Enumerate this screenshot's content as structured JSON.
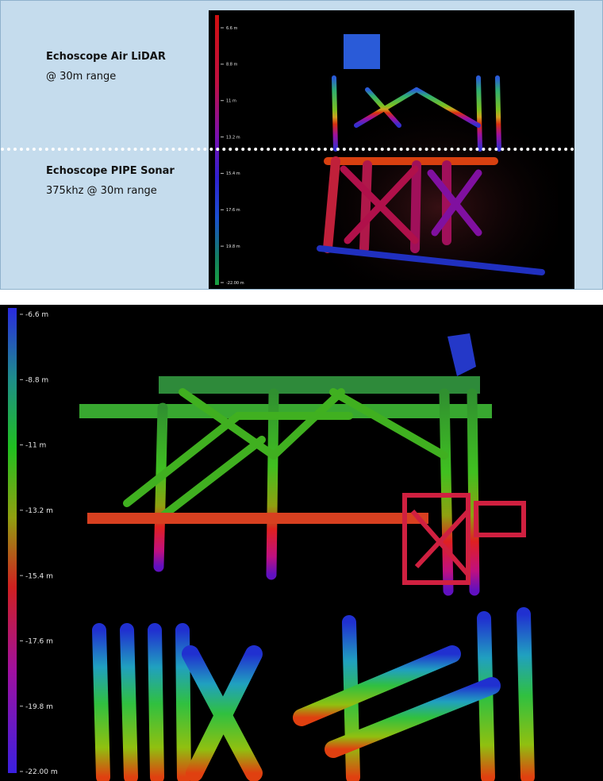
{
  "top_panel": {
    "lidar": {
      "title": "Echoscope Air LiDAR",
      "subtitle": "@ 30m range"
    },
    "sonar": {
      "title": "Echoscope PIPE Sonar",
      "subtitle": "375khz @ 30m range"
    },
    "scale": {
      "bar_colors": [
        "#d01010",
        "#c01040",
        "#7a10b0",
        "#3020d0",
        "#1a4fd0",
        "#148060",
        "#18a040"
      ],
      "ticks": [
        "6.6 m",
        "8.8 m",
        "11 m",
        "13.2 m",
        "15.4 m",
        "17.6 m",
        "19.8 m",
        "-22.00 m"
      ]
    }
  },
  "bottom_panel": {
    "scale": {
      "bar_colors": [
        "#2a2ae0",
        "#1e8c8c",
        "#20c020",
        "#90a010",
        "#d02020",
        "#a010a0",
        "#3a20e0"
      ],
      "ticks": [
        "-6.6 m",
        "-8.8 m",
        "-11 m",
        "-13.2 m",
        "-15.4 m",
        "-17.6 m",
        "-19.8 m",
        "-22.00 m"
      ]
    }
  }
}
